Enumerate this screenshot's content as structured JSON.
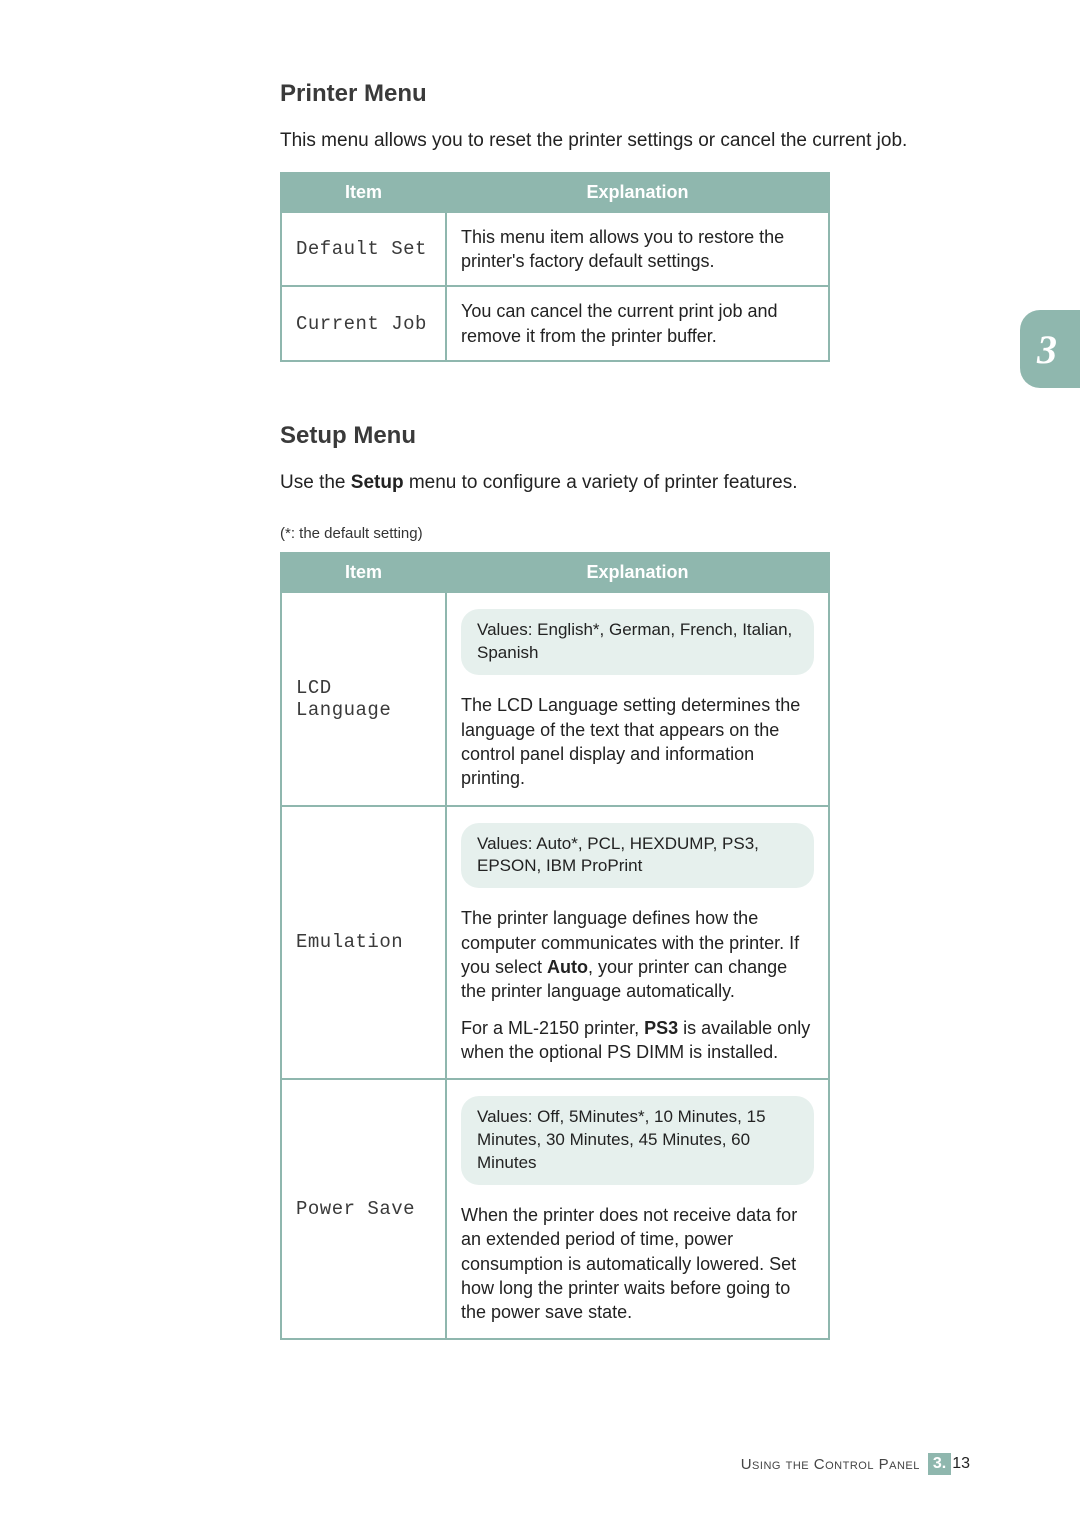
{
  "chapter_tab": "3",
  "sections": {
    "printer": {
      "heading": "Printer Menu",
      "intro": "This menu allows you to reset the printer settings or cancel the current job.",
      "headers": {
        "item": "Item",
        "explanation": "Explanation"
      },
      "rows": [
        {
          "item": "Default Set",
          "explanation": "This menu item allows you to restore the printer's factory default settings."
        },
        {
          "item": "Current Job",
          "explanation": "You can cancel the current print job and remove it from the printer buffer."
        }
      ]
    },
    "setup": {
      "heading": "Setup Menu",
      "intro_pre": "Use the ",
      "intro_bold": "Setup",
      "intro_post": " menu to configure a variety of printer features.",
      "note": "(*: the default setting)",
      "headers": {
        "item": "Item",
        "explanation": "Explanation"
      },
      "rows": {
        "lcd": {
          "item": "LCD Language",
          "values": "Values: English*, German, French, Italian, Spanish",
          "desc": "The LCD Language setting determines the language of the text that appears on the control panel display and information printing."
        },
        "emulation": {
          "item": "Emulation",
          "values": "Values: Auto*, PCL, HEXDUMP, PS3, EPSON, IBM ProPrint",
          "desc1_pre": "The printer language defines how the computer communicates with the printer. If you select ",
          "desc1_bold": "Auto",
          "desc1_post": ", your printer can change the printer language automatically.",
          "desc2_pre": "For a ML-2150 printer, ",
          "desc2_bold": "PS3",
          "desc2_post": " is available only when the optional PS DIMM is installed."
        },
        "powersave": {
          "item": "Power Save",
          "values": "Values: Off,  5Minutes*, 10 Minutes, 15 Minutes, 30 Minutes, 45 Minutes, 60 Minutes",
          "desc": "When the printer does not receive data for an extended period of time, power consumption is automatically lowered. Set how long the printer waits before going to the power save state."
        }
      }
    }
  },
  "footer": {
    "text": "Using the Control Panel",
    "chapter": "3.",
    "page": "13"
  }
}
